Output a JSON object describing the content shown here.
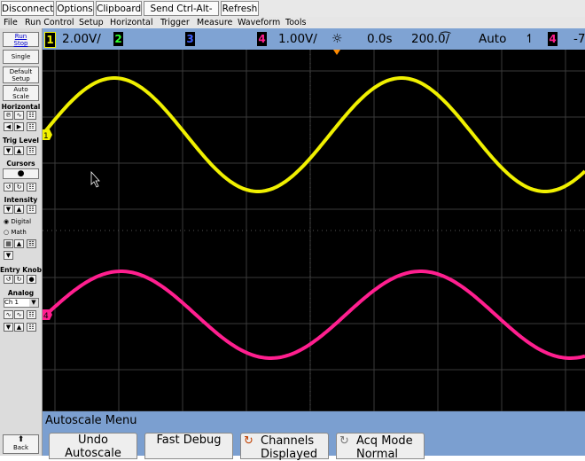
{
  "toolbar": {
    "disconnect": "Disconnect",
    "options": "Options",
    "clipboard": "Clipboard",
    "send_cad": "Send Ctrl-Alt-Del",
    "refresh": "Refresh"
  },
  "menu": {
    "file": "File",
    "run_control": "Run Control",
    "setup": "Setup",
    "horizontal": "Horizontal",
    "trigger": "Trigger",
    "measure": "Measure",
    "waveform": "Waveform",
    "tools": "Tools"
  },
  "left_panel": {
    "run_stop": "Run\nStop",
    "single": "Single",
    "default_setup": "Default\nSetup",
    "auto_scale": "Auto\nScale",
    "horizontal": "Horizontal",
    "trig_level": "Trig Level",
    "cursors": "Cursors",
    "intensity": "Intensity",
    "digital": "Digital",
    "math": "Math",
    "entry_knob": "Entry Knob",
    "analog": "Analog",
    "ch_select": "Ch 1",
    "back": "Back"
  },
  "status_bar": {
    "ch1_num": "1",
    "ch1_scale": "2.00V/",
    "ch2_num": "2",
    "ch3_num": "3",
    "ch4_num": "4",
    "ch4_scale": "1.00V/",
    "time_delay": "0.0s",
    "time_scale": "200.0͡/",
    "trigger_mode": "Auto",
    "trigger_source": "4",
    "trailing": "-7"
  },
  "markers": {
    "ch1": "1",
    "ch4": "4"
  },
  "softkeys": {
    "menu_title": "Autoscale Menu",
    "undo": "Undo\nAutoscale",
    "fast_debug": "Fast Debug",
    "channels": "Channels\nDisplayed",
    "acq_mode": "Acq Mode\nNormal"
  },
  "colors": {
    "ch1": "#f0f000",
    "ch2": "#30ff30",
    "ch3": "#4060ff",
    "ch4": "#ff1f8f",
    "status_bg": "#7fa3d3",
    "trigger_marker": "#ff8a00"
  }
}
